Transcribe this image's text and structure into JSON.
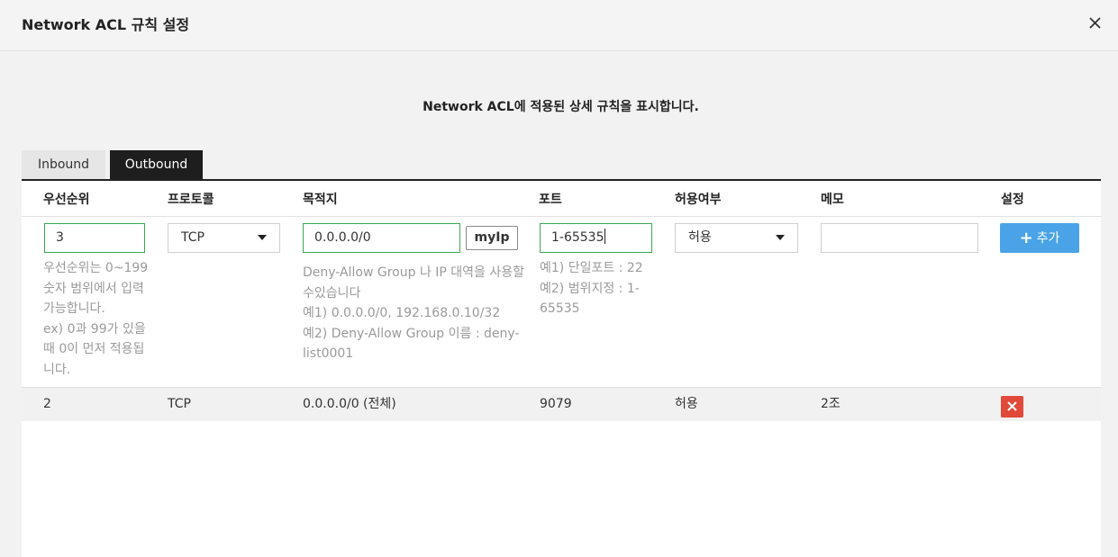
{
  "dialog": {
    "title": "Network ACL 규칙 설정",
    "subtitle": "Network ACL에 적용된 상세 규칙을 표시합니다."
  },
  "tabs": [
    {
      "label": "Inbound",
      "active": false
    },
    {
      "label": "Outbound",
      "active": true
    }
  ],
  "table": {
    "headers": [
      "우선순위",
      "프로토콜",
      "목적지",
      "포트",
      "허용여부",
      "메모",
      "설정"
    ],
    "form": {
      "priority_value": "3",
      "protocol_value": "TCP",
      "destination_value": "0.0.0.0/0",
      "myip_label": "myIp",
      "port_value": "1-65535",
      "allow_value": "허용",
      "memo_value": "",
      "add_label": "추가"
    },
    "help": {
      "priority": [
        "우선순위는 0~199",
        "숫자 범위에서 입력",
        "가능합니다.",
        "ex) 0과 99가 있을",
        "때 0이 먼저 적용됩",
        "니다."
      ],
      "destination": [
        "Deny-Allow Group 나 IP 대역을 사용할",
        "수있습니다",
        "예1) 0.0.0.0/0, 192.168.0.10/32",
        "예2) Deny-Allow Group 이름 : deny-",
        "list0001"
      ],
      "port": [
        "예1) 단일포트 : 22",
        "예2) 범위지정 : 1-",
        "65535"
      ]
    },
    "rows": [
      {
        "priority": "2",
        "protocol": "TCP",
        "destination": "0.0.0.0/0 (전체)",
        "port": "9079",
        "allow": "허용",
        "memo": "2조"
      }
    ]
  },
  "colors": {
    "accent": "#4aa3e6",
    "active_tab": "#1e1e1e",
    "valid_border": "#3aa651",
    "delete": "#e1493a"
  }
}
